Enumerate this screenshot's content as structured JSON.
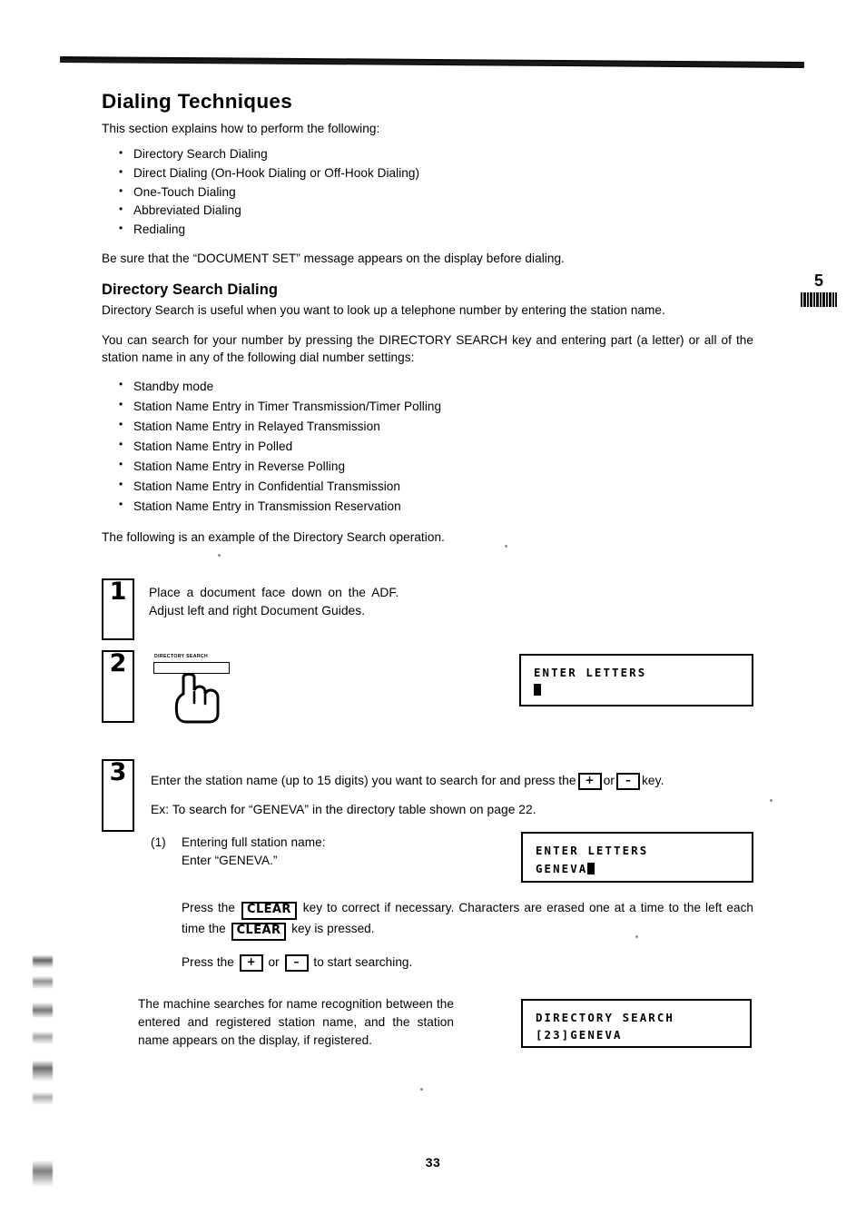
{
  "document": {
    "page_number": "33",
    "chapter_marker": "5"
  },
  "section": {
    "title": "Dialing Techniques",
    "intro": "This section explains how to perform the following:",
    "techniques": [
      "Directory Search Dialing",
      "Direct Dialing (On-Hook Dialing or Off-Hook Dialing)",
      "One-Touch Dialing",
      "Abbreviated Dialing",
      "Redialing"
    ],
    "note": "Be sure that the “DOCUMENT SET” message appears on the display before dialing."
  },
  "directory_search": {
    "heading": "Directory Search Dialing",
    "lead": "Directory Search is useful when you want to look up a telephone number by entering the station name.",
    "explanation": "You can search for your number by pressing the DIRECTORY SEARCH key and entering part (a letter) or all of the station name in any of the following dial number settings:",
    "modes": [
      "Standby mode",
      "Station Name Entry in Timer Transmission/Timer Polling",
      "Station Name Entry in Relayed Transmission",
      "Station Name Entry in Polled",
      "Station Name Entry in Reverse Polling",
      "Station Name Entry in Confidential Transmission",
      "Station Name Entry in Transmission Reservation"
    ],
    "example_lead": "The following is an example of the Directory Search operation."
  },
  "steps": [
    {
      "number": "1",
      "line1": "Place a document face down on the ADF.",
      "line2": "Adjust left and right Document Guides."
    },
    {
      "number": "2",
      "key_caption": "DIRECTORY SEARCH"
    },
    {
      "number": "3",
      "instruction_pre": "Enter the station name (up to 15 digits) you want to search for and press the",
      "key_plus": "+",
      "instruction_or": "or",
      "key_minus": "–",
      "instruction_post": "key.",
      "example": "Ex: To search for “GENEVA” in the directory table shown on page 22."
    }
  ],
  "substep": {
    "marker": "(1)",
    "line1": "Entering full station name:",
    "line2": "Enter “GENEVA.”",
    "clear_pre": "Press the",
    "clear_key": "CLEAR",
    "clear_mid": "key to correct if necessary. Characters are erased one at a time to the left each time the",
    "clear_post": "key is pressed.",
    "search_pre": "Press the",
    "search_plus": "+",
    "search_or": "or",
    "search_minus": "–",
    "search_post": "to start searching."
  },
  "result": {
    "text": "The machine searches for name recognition between the entered and registered station name, and the station name appears on the display, if registered."
  },
  "displays": [
    {
      "id": "enter-letters-empty",
      "line1": "ENTER LETTERS",
      "line2": ""
    },
    {
      "id": "enter-letters-geneva",
      "line1": "ENTER LETTERS",
      "line2": "GENEVA"
    },
    {
      "id": "directory-search-result",
      "line1": "DIRECTORY SEARCH",
      "line2": "[23]GENEVA"
    }
  ],
  "colors": {
    "ink": "#000000",
    "paper": "#ffffff"
  }
}
